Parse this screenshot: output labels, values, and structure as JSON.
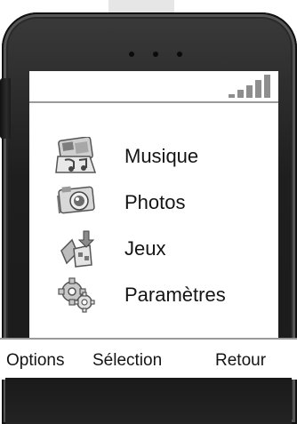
{
  "status": {
    "signal_bars": 5,
    "signal_color": "#8e8e8e"
  },
  "menu": {
    "items": [
      {
        "label": "Musique",
        "icon": "music-icon"
      },
      {
        "label": "Photos",
        "icon": "camera-icon"
      },
      {
        "label": "Jeux",
        "icon": "games-icon"
      },
      {
        "label": "Paramètres",
        "icon": "settings-gear-icon"
      }
    ]
  },
  "softkeys": {
    "left": "Options",
    "center": "Sélection",
    "right": "Retour"
  },
  "colors": {
    "screen_background": "#ffffff",
    "text": "#141414",
    "divider": "#9a9a9a",
    "phone_body": "#1e1e1e"
  }
}
